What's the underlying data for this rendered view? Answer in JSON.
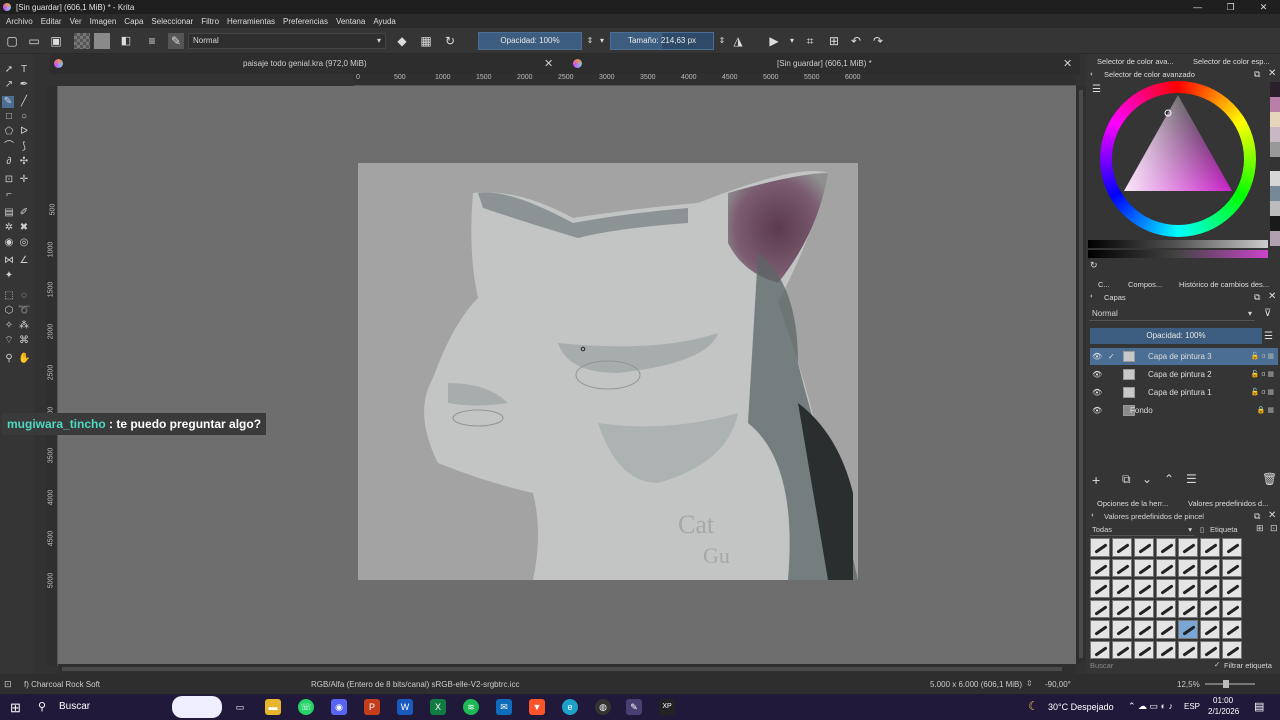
{
  "window": {
    "title": "[Sin guardar]  (606,1 MiB) * - Krita",
    "controls": [
      "—",
      "❐",
      "✕"
    ]
  },
  "menu": [
    "Archivo",
    "Editar",
    "Ver",
    "Imagen",
    "Capa",
    "Seleccionar",
    "Filtro",
    "Herramientas",
    "Preferencias",
    "Ventana",
    "Ayuda"
  ],
  "toolbar": {
    "blend_mode": "Normal",
    "opacity": "Opacidad: 100%",
    "size": "Tamaño: 214,63 px"
  },
  "tabs": [
    {
      "label": "paisaje todo genial.kra (972,0 MiB)"
    },
    {
      "label": "[Sin guardar]  (606,1 MiB) *"
    }
  ],
  "ruler": {
    "h": [
      "0",
      "500",
      "1000",
      "1500",
      "2000",
      "2500",
      "3000",
      "3500",
      "4000",
      "4500",
      "5000",
      "5500",
      "6000"
    ],
    "v": [
      "500",
      "1000",
      "1500",
      "2000",
      "2500",
      "3000",
      "3500",
      "4000",
      "4500",
      "5000"
    ]
  },
  "chat": {
    "user": "mugiwara_tincho",
    "message": " : te puedo preguntar algo?"
  },
  "docker": {
    "color_tabs": [
      "Selector de color ava...",
      "Selector de color esp..."
    ],
    "color_title": "Selector de color avanzado",
    "layer_tabs": [
      "C...",
      "Compos...",
      "Histórico de cambios des..."
    ],
    "layers_title": "Capas",
    "blend": "Normal",
    "opacity": "Opacidad:  100%",
    "layers": [
      {
        "name": "Capa de pintura 3"
      },
      {
        "name": "Capa de pintura 2"
      },
      {
        "name": "Capa de pintura 1"
      },
      {
        "name": "Fondo"
      }
    ],
    "preset_tabs": [
      "Opciones de la herr...",
      "Valores predefinidos d..."
    ],
    "preset_title": "Valores predefinidos de pincel",
    "preset_filter": "Todas",
    "tag_label": "Etiqueta",
    "search_placeholder": "Buscar",
    "filter_tag": "Filtrar etiqueta"
  },
  "status": {
    "brush": "f) Charcoal Rock Soft",
    "color_space": "RGB/Alfa (Entero de 8 bits/canal)  sRGB-elle-V2-srgbtrc.icc",
    "dims": "5.000 x 6.000 (606,1 MiB)",
    "rotation": "-90,00°",
    "zoom": "12,5%"
  },
  "taskbar": {
    "search": "Buscar",
    "weather": "30°C  Despejado",
    "lang": "ESP",
    "time": "01:00",
    "date": "2/1/2026"
  },
  "colors": {
    "accent": "#3c5d80",
    "swatches": [
      "#2a1f2a",
      "#b97fa8",
      "#e8d4b8",
      "#c9b8c4",
      "#999999",
      "#333333",
      "#d6d6d6",
      "#778899",
      "#bcbcbc",
      "#1a1a1a",
      "#b0a0b0"
    ]
  }
}
